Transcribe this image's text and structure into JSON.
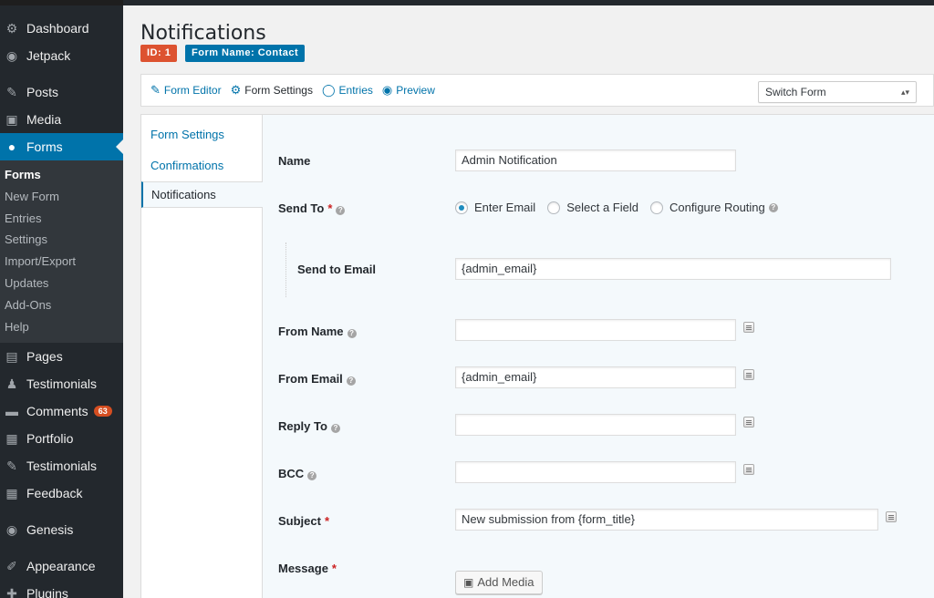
{
  "sidebar": {
    "items": [
      {
        "label": "Dashboard",
        "icon": "dashboard-icon",
        "glyph": "⚙"
      },
      {
        "label": "Jetpack",
        "icon": "jetpack-icon",
        "glyph": "◉"
      },
      {
        "label": "Posts",
        "icon": "pin-icon",
        "glyph": "✎"
      },
      {
        "label": "Media",
        "icon": "media-icon",
        "glyph": "▣"
      },
      {
        "label": "Forms",
        "icon": "forms-icon",
        "glyph": "●"
      },
      {
        "label": "Pages",
        "icon": "pages-icon",
        "glyph": "▤"
      },
      {
        "label": "Testimonials",
        "icon": "person-icon",
        "glyph": "♟"
      },
      {
        "label": "Comments",
        "icon": "comment-icon",
        "glyph": "▬",
        "badge": "63"
      },
      {
        "label": "Portfolio",
        "icon": "portfolio-icon",
        "glyph": "▦"
      },
      {
        "label": "Testimonials",
        "icon": "pin-icon",
        "glyph": "✎"
      },
      {
        "label": "Feedback",
        "icon": "feedback-icon",
        "glyph": "▦"
      },
      {
        "label": "Genesis",
        "icon": "genesis-icon",
        "glyph": "◉"
      },
      {
        "label": "Appearance",
        "icon": "brush-icon",
        "glyph": "✐"
      },
      {
        "label": "Plugins",
        "icon": "plug-icon",
        "glyph": "✚"
      }
    ],
    "forms_submenu": [
      "Forms",
      "New Form",
      "Entries",
      "Settings",
      "Import/Export",
      "Updates",
      "Add-Ons",
      "Help"
    ]
  },
  "header": {
    "title": "Notifications",
    "id_tag": "ID: 1",
    "form_tag": "Form Name: Contact"
  },
  "toolbar": {
    "form_editor": "Form Editor",
    "form_settings": "Form Settings",
    "entries": "Entries",
    "preview": "Preview",
    "switch_form": "Switch Form"
  },
  "tabs": [
    "Form Settings",
    "Confirmations",
    "Notifications"
  ],
  "fields": {
    "name_label": "Name",
    "name_value": "Admin Notification",
    "send_to_label": "Send To",
    "send_to_options": [
      "Enter Email",
      "Select a Field",
      "Configure Routing"
    ],
    "send_to_email_label": "Send to Email",
    "send_to_email_value": "{admin_email}",
    "from_name_label": "From Name",
    "from_name_value": "",
    "from_email_label": "From Email",
    "from_email_value": "{admin_email}",
    "reply_to_label": "Reply To",
    "reply_to_value": "",
    "bcc_label": "BCC",
    "bcc_value": "",
    "subject_label": "Subject",
    "subject_value": "New submission from {form_title}",
    "message_label": "Message",
    "add_media": "Add Media",
    "required_mark": "*",
    "help_mark": "?"
  }
}
